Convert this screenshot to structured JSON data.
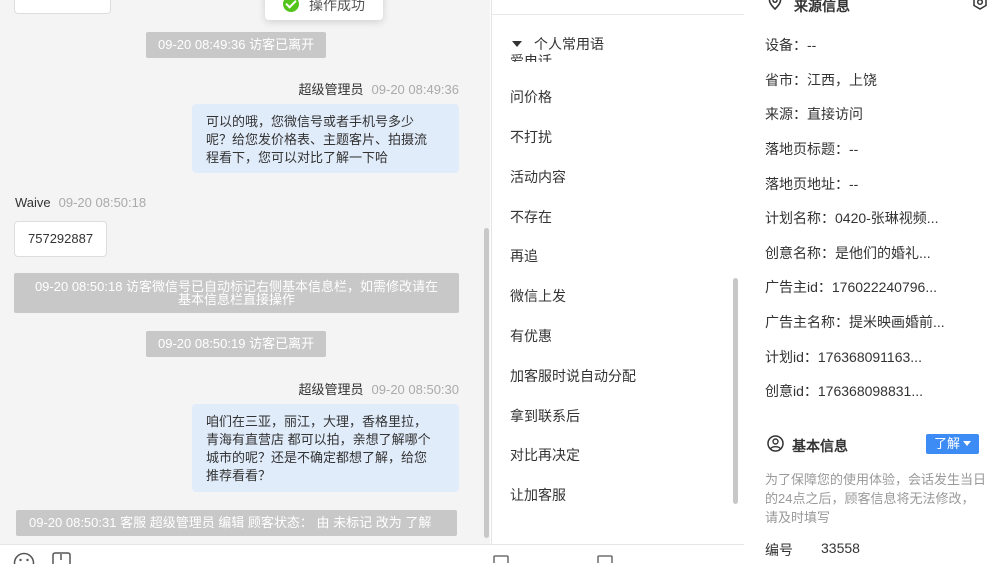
{
  "toast": {
    "text": "操作成功"
  },
  "chat": {
    "system_1": "09-20 08:49:36 访客已离开",
    "msg_1": {
      "sender": "超级管理员",
      "time": "09-20 08:49:36",
      "lines": [
        "可以的哦，您微信号或者手机号多少",
        "呢？给您发价格表、主题客片、拍摄流",
        "程看下，您可以对比了解一下哈"
      ]
    },
    "msg_2": {
      "sender": "Waive",
      "time": "09-20 08:50:18",
      "text": "757292887"
    },
    "system_2": {
      "lines": [
        "09-20 08:50:18 访客微信号已自动标记右侧基本信息栏，如需修改请在",
        "基本信息栏直接操作"
      ]
    },
    "system_3": "09-20 08:50:19 访客已离开",
    "msg_3": {
      "sender": "超级管理员",
      "time": "09-20 08:50:30",
      "lines": [
        "咱们在三亚，丽江，大理，香格里拉，",
        "青海有直营店 都可以拍，亲想了解哪个",
        "城市的呢？还是不确定都想了解，给您",
        "推荐看看？"
      ]
    },
    "system_4": "09-20 08:50:31 客服 超级管理员 编辑 顾客状态： 由 未标记 改为 了解"
  },
  "phrases": {
    "header": "个人常用语",
    "clipped_item": "爱电话",
    "items": [
      "问价格",
      "不打扰",
      "活动内容",
      "不存在",
      "再追",
      "微信上发",
      "有优惠",
      "加客服时说自动分配",
      "拿到联系后",
      "对比再决定",
      "让加客服"
    ]
  },
  "info": {
    "source_title": "来源信息",
    "rows": [
      "设备：--",
      "省市：江西，上饶",
      "来源：直接访问",
      "落地页标题：--",
      "落地页地址：--",
      "计划名称：0420-张琳视频...",
      "创意名称：是他们的婚礼...",
      "广告主id：176022240796...",
      "广告主名称：提米映画婚前...",
      "计划id：176368091163...",
      "创意id：176368098831..."
    ],
    "basic_title": "基本信息",
    "learn_button": "了解",
    "basic_notice": "为了保障您的使用体验，会话发生当日的24点之后，顾客信息将无法修改，请及时填写",
    "serial_label": "编号",
    "serial_value": "33558"
  },
  "colors": {
    "accent": "#3d8cf5",
    "bubble": "#e1ecfb",
    "system_pill": "#c8c8c8",
    "success": "#52c41a"
  }
}
